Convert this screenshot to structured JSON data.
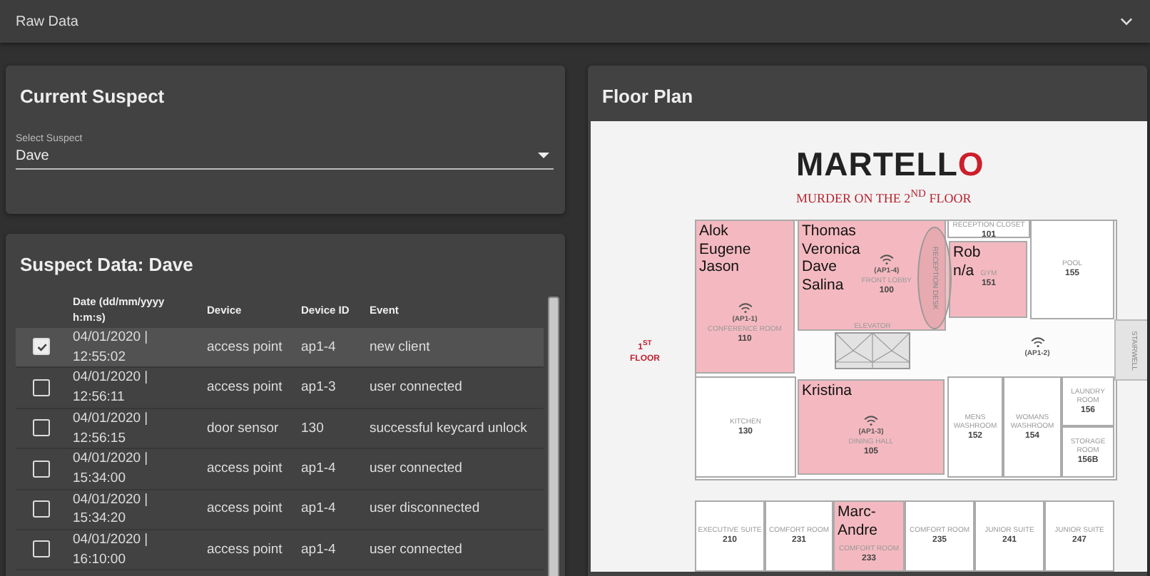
{
  "header": {
    "title": "Raw Data",
    "expanded": false
  },
  "current_suspect": {
    "title": "Current Suspect",
    "select": {
      "label": "Select Suspect",
      "value": "Dave"
    }
  },
  "suspect_data": {
    "title": "Suspect Data: Dave",
    "columns": [
      "Date (dd/mm/yyyy h:m:s)",
      "Device",
      "Device ID",
      "Event"
    ],
    "rows": [
      {
        "selected": true,
        "date": "04/01/2020 | 12:55:02",
        "device": "access point",
        "device_id": "ap1-4",
        "event": "new client"
      },
      {
        "selected": false,
        "date": "04/01/2020 | 12:56:11",
        "device": "access point",
        "device_id": "ap1-3",
        "event": "user connected"
      },
      {
        "selected": false,
        "date": "04/01/2020 | 12:56:15",
        "device": "door sensor",
        "device_id": "130",
        "event": "successful keycard unlock"
      },
      {
        "selected": false,
        "date": "04/01/2020 | 15:34:00",
        "device": "access point",
        "device_id": "ap1-4",
        "event": "user connected"
      },
      {
        "selected": false,
        "date": "04/01/2020 | 15:34:20",
        "device": "access point",
        "device_id": "ap1-4",
        "event": "user disconnected"
      },
      {
        "selected": false,
        "date": "04/01/2020 | 16:10:00",
        "device": "access point",
        "device_id": "ap1-4",
        "event": "user connected"
      }
    ]
  },
  "floor_plan": {
    "title": "Floor Plan",
    "logo": "MARTELLO",
    "subtitle": "MURDER ON THE 2$^{ND}$ FLOOR",
    "floor_label": "1$^{ST}$ FLOOR",
    "rooms": [
      {
        "number": "110",
        "name": "CONFERENCE ROOM",
        "occupants": [
          "Alok",
          "Eugene",
          "Jason"
        ],
        "highlighted": true,
        "access_point": "(AP1-1)"
      },
      {
        "number": "100",
        "name": "FRONT LOBBY",
        "occupants": [
          "Thomas",
          "Veronica",
          "Dave",
          "Salina"
        ],
        "highlighted": true,
        "access_point": "(AP1-4)"
      },
      {
        "number": "101",
        "name": "RECEPTION CLOSET",
        "highlighted": false
      },
      {
        "number": "151",
        "name": "GYM",
        "occupants": [
          "Rob",
          "n/a"
        ],
        "highlighted": true
      },
      {
        "number": "155",
        "name": "POOL",
        "highlighted": false
      },
      {
        "number": "130",
        "name": "KITCHEN",
        "highlighted": false
      },
      {
        "number": "105",
        "name": "DINING HALL",
        "occupants": [
          "Kristina"
        ],
        "highlighted": true,
        "access_point": "(AP1-3)"
      },
      {
        "number": "152",
        "name": "MENS WASHROOM",
        "highlighted": false
      },
      {
        "number": "154",
        "name": "WOMANS WASHROOM",
        "highlighted": false
      },
      {
        "number": "156",
        "name": "LAUNDRY ROOM",
        "highlighted": false
      },
      {
        "number": "156B",
        "name": "STORAGE ROOM",
        "highlighted": false
      },
      {
        "number": "210",
        "name": "EXECUTIVE SUITE",
        "highlighted": false
      },
      {
        "number": "231",
        "name": "COMFORT ROOM",
        "highlighted": false
      },
      {
        "number": "233",
        "name": "COMFORT ROOM",
        "occupants": [
          "Marc-Andre"
        ],
        "highlighted": true
      },
      {
        "number": "235",
        "name": "COMFORT ROOM",
        "highlighted": false
      },
      {
        "number": "241",
        "name": "JUNIOR SUITE",
        "highlighted": false
      },
      {
        "number": "247",
        "name": "JUNIOR SUITE",
        "highlighted": false
      }
    ],
    "features": [
      {
        "kind": "reception-desk",
        "label": "RECEPTION DESK"
      },
      {
        "kind": "elevator",
        "label": "ELEVATOR"
      },
      {
        "kind": "access-point",
        "label": "(AP1-2)"
      },
      {
        "kind": "stairwell",
        "label": "STAIRWELL"
      }
    ]
  }
}
